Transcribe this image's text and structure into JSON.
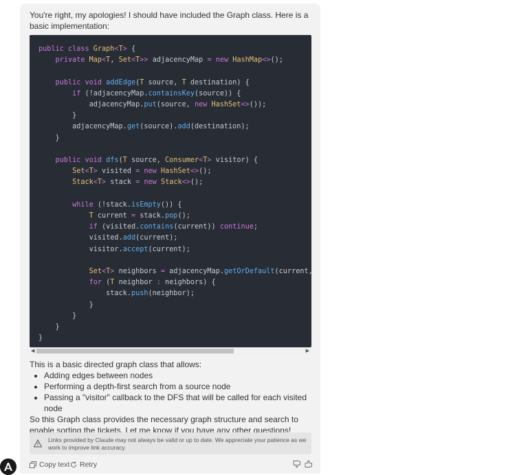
{
  "message": {
    "intro": "You're right, my apologies! I should have included the Graph class. Here is a basic implementation:",
    "code_lines": [
      "public class Graph<T> {",
      "    private Map<T, Set<T>> adjacencyMap = new HashMap<>();",
      "",
      "    public void addEdge(T source, T destination) {",
      "        if (!adjacencyMap.containsKey(source)) {",
      "            adjacencyMap.put(source, new HashSet<>());",
      "        }",
      "        adjacencyMap.get(source).add(destination);",
      "    }",
      "",
      "    public void dfs(T source, Consumer<T> visitor) {",
      "        Set<T> visited = new HashSet<>();",
      "        Stack<T> stack = new Stack<>();",
      "",
      "        while (!stack.isEmpty()) {",
      "            T current = stack.pop();",
      "            if (visited.contains(current)) continue;",
      "            visited.add(current);",
      "            visitor.accept(current);",
      "",
      "            Set<T> neighbors = adjacencyMap.getOrDefault(current, C",
      "            for (T neighbor : neighbors) {",
      "                stack.push(neighbor);",
      "            }",
      "        }",
      "    }",
      "}"
    ],
    "summary_lead": "This is a basic directed graph class that allows:",
    "bullets": [
      "Adding edges between nodes",
      "Performing a depth-first search from a source node",
      "Passing a \"visitor\" callback to the DFS that will be called for each visited node"
    ],
    "closing": "So this Graph class provides the necessary graph structure and search to enable sorting the tickets. Let me know if you have any other questions!"
  },
  "notice": {
    "text": "Links provided by Claude may not always be valid or up to date. We appreciate your patience as we work to improve link accuracy.",
    "icon": "warning-icon"
  },
  "actions": {
    "copy_label": "Copy text",
    "retry_label": "Retry"
  },
  "colors": {
    "code_bg": "#282c34",
    "keyword": "#c678dd",
    "type": "#e5c07b",
    "function": "#61afef"
  }
}
